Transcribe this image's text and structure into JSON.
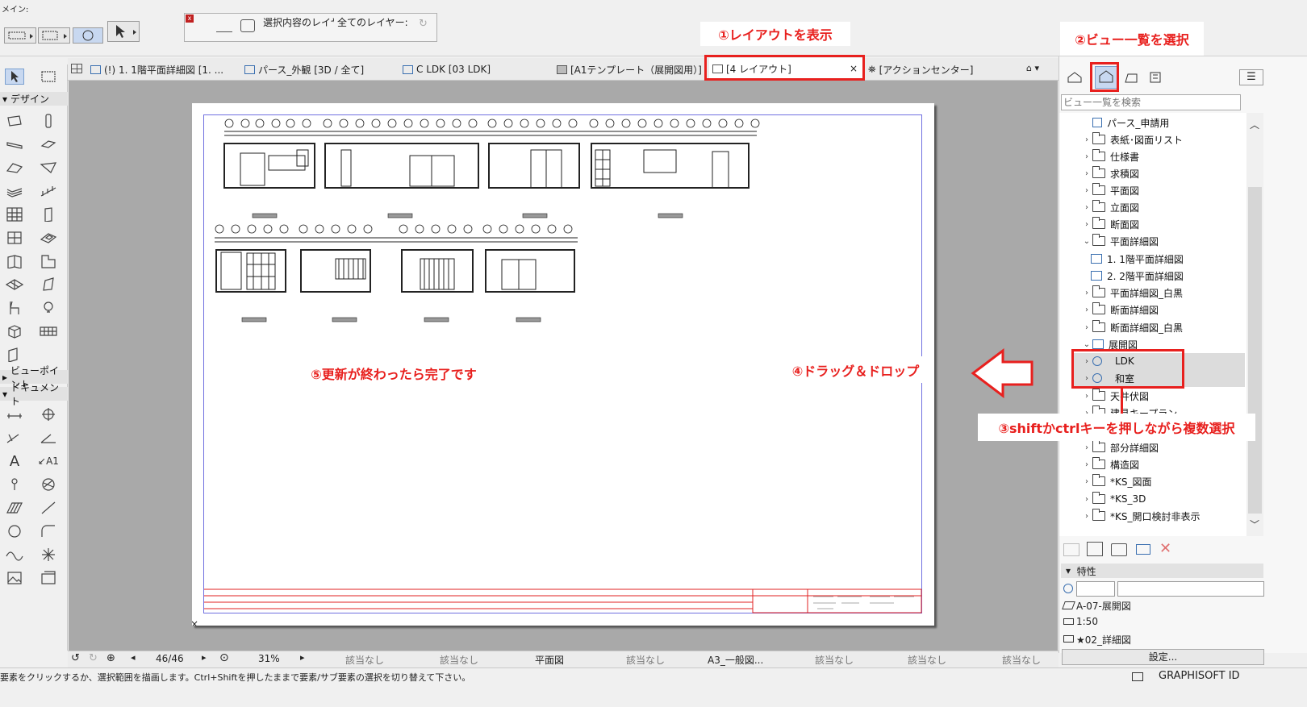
{
  "menu": {
    "label": "メイン:"
  },
  "toolbar": {
    "layer_selected_label": "選択内容のレイヤー",
    "layer_all_label": "全てのレイヤー:"
  },
  "tabs": [
    {
      "label": "(!) 1. 1階平面詳細図 [1. ..."
    },
    {
      "label": "パース_外観 [3D / 全て]"
    },
    {
      "label": "C LDK [03 LDK]"
    },
    {
      "label": "[A1テンプレート（展開図用）]"
    },
    {
      "label": "[4 レイアウト]",
      "close": "×"
    },
    {
      "label": "[アクションセンター]"
    }
  ],
  "toolbox": {
    "design": "デザイン",
    "viewpoint": "ビューポイント",
    "document": "ドキュメント"
  },
  "navigator": {
    "search_placeholder": "ビュー一覧を検索",
    "items": [
      {
        "label": "パース_申請用",
        "type": "3d",
        "indent": 0
      },
      {
        "label": "表紙･図面リスト",
        "type": "folder",
        "indent": 0
      },
      {
        "label": "仕様書",
        "type": "folder",
        "indent": 0
      },
      {
        "label": "求積図",
        "type": "folder",
        "indent": 0
      },
      {
        "label": "平面図",
        "type": "folder",
        "indent": 0
      },
      {
        "label": "立面図",
        "type": "folder",
        "indent": 0
      },
      {
        "label": "断面図",
        "type": "folder",
        "indent": 0
      },
      {
        "label": "平面詳細図",
        "type": "folder-open",
        "indent": 0
      },
      {
        "label": "1. 1階平面詳細図",
        "type": "plan",
        "indent": 1
      },
      {
        "label": "2. 2階平面詳細図",
        "type": "plan",
        "indent": 1
      },
      {
        "label": "平面詳細図_白黒",
        "type": "folder",
        "indent": 0
      },
      {
        "label": "断面詳細図",
        "type": "folder",
        "indent": 0
      },
      {
        "label": "断面詳細図_白黒",
        "type": "folder",
        "indent": 0
      },
      {
        "label": "展開図",
        "type": "folder-open",
        "indent": 0
      },
      {
        "label": "LDK",
        "type": "elev",
        "indent": 1
      },
      {
        "label": "和室",
        "type": "elev",
        "indent": 1
      },
      {
        "label": "天井伏図",
        "type": "folder",
        "indent": 0
      },
      {
        "label": "建具キープラン",
        "type": "folder",
        "indent": 0
      },
      {
        "label": "",
        "type": "folder",
        "indent": 0
      },
      {
        "label": "部分詳細図",
        "type": "folder",
        "indent": 0
      },
      {
        "label": "構造図",
        "type": "folder",
        "indent": 0
      },
      {
        "label": "*KS_図面",
        "type": "folder",
        "indent": 0
      },
      {
        "label": "*KS_3D",
        "type": "folder",
        "indent": 0
      },
      {
        "label": "*KS_開口検討非表示",
        "type": "folder",
        "indent": 0
      }
    ]
  },
  "properties": {
    "header": "特性",
    "layer": "A-07-展開図",
    "scale": "1:50",
    "pen_set": "★02_詳細図",
    "settings_button": "設定..."
  },
  "bottom_bar": {
    "page": "46/46",
    "zoom": "31%",
    "na": "該当なし",
    "plan": "平面図",
    "paper": "A3_一般図..."
  },
  "status": {
    "message": "要素をクリックするか、選択範囲を描画します。Ctrl+Shiftを押したままで要素/サブ要素の選択を切り替えて下さい。",
    "brand": "GRAPHISOFT ID"
  },
  "annotations": {
    "step1": "①レイアウトを表示",
    "step2": "②ビュー一覧を選択",
    "step3": "③shiftかctrlキーを押しながら複数選択",
    "step4": "④ドラッグ＆ドロップ",
    "step5": "⑤更新が終わったら完了です"
  },
  "colors": {
    "accent": "#e8201e",
    "frame": "#7070e0",
    "titleblock": "#e02020"
  }
}
